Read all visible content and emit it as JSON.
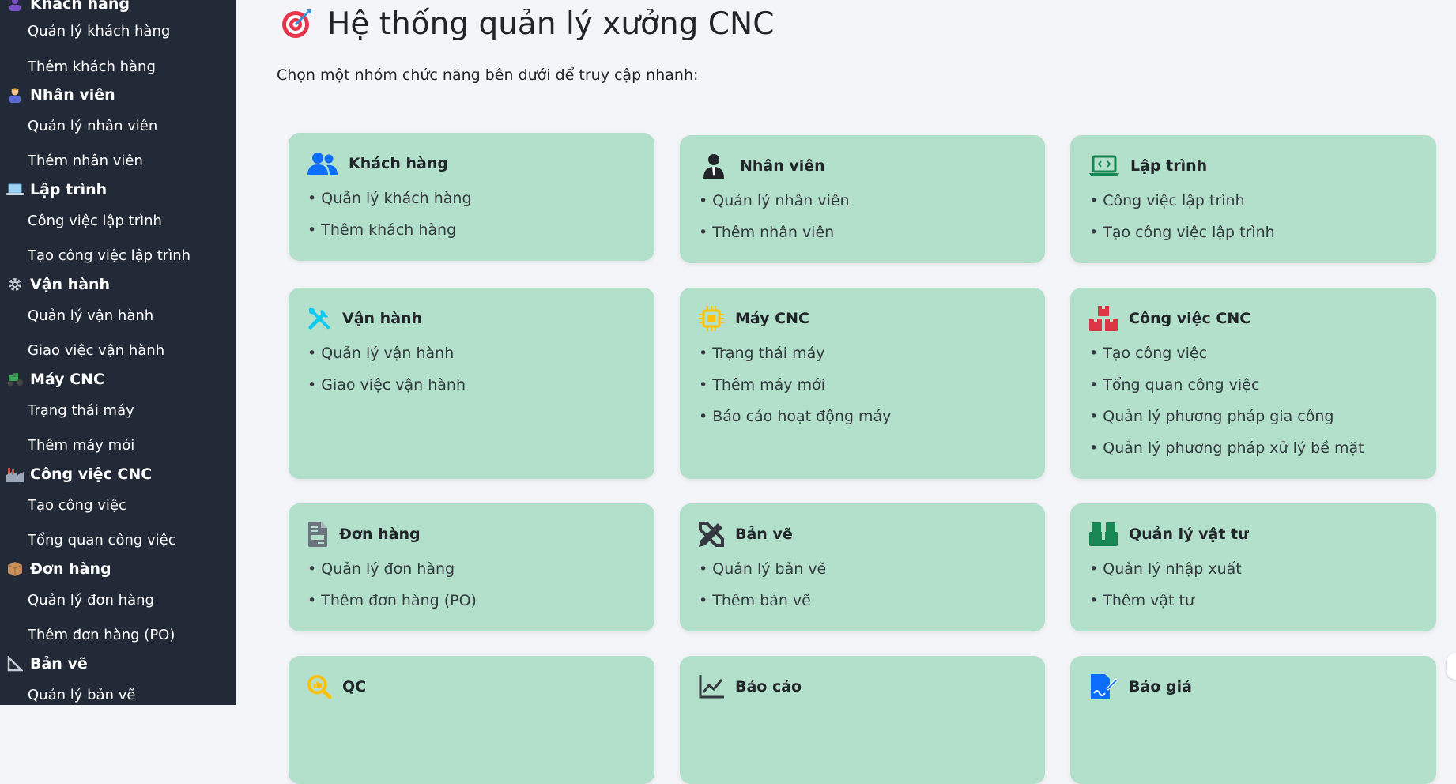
{
  "sidebar": {
    "groups": [
      {
        "title": "Khách hàng",
        "icon": "purple-person-icon",
        "links": [
          "Quản lý khách hàng",
          "Thêm khách hàng"
        ]
      },
      {
        "title": "Nhân viên",
        "icon": "worker-icon",
        "links": [
          "Quản lý nhân viên",
          "Thêm nhân viên"
        ]
      },
      {
        "title": "Lập trình",
        "icon": "laptop-icon",
        "links": [
          "Công việc lập trình",
          "Tạo công việc lập trình"
        ]
      },
      {
        "title": "Vận hành",
        "icon": "gear-icon",
        "links": [
          "Quản lý vận hành",
          "Giao việc vận hành"
        ]
      },
      {
        "title": "Máy CNC",
        "icon": "tractor-icon",
        "links": [
          "Trạng thái máy",
          "Thêm máy mới"
        ]
      },
      {
        "title": "Công việc CNC",
        "icon": "factory-icon",
        "links": [
          "Tạo công việc",
          "Tổng quan công việc"
        ]
      },
      {
        "title": "Đơn hàng",
        "icon": "package-icon",
        "links": [
          "Quản lý đơn hàng",
          "Thêm đơn hàng (PO)"
        ]
      },
      {
        "title": "Bản vẽ",
        "icon": "triangle-ruler-icon",
        "links": [
          "Quản lý bản vẽ"
        ]
      }
    ]
  },
  "main": {
    "title": "Hệ thống quản lý xưởng CNC",
    "title_icon": "target-icon",
    "subtitle": "Chọn một nhóm chức năng bên dưới để truy cập nhanh:",
    "cards": [
      {
        "title": "Khách hàng",
        "icon": "people-icon",
        "icon_color": "#0d6efd",
        "items": [
          "• Quản lý khách hàng",
          "• Thêm khách hàng"
        ]
      },
      {
        "title": "Nhân viên",
        "icon": "person-tie-icon",
        "icon_color": "#212529",
        "items": [
          "• Quản lý nhân viên",
          "• Thêm nhân viên"
        ]
      },
      {
        "title": "Lập trình",
        "icon": "laptop-code-icon",
        "icon_color": "#198754",
        "items": [
          "• Công việc lập trình",
          "• Tạo công việc lập trình"
        ]
      },
      {
        "title": "Vận hành",
        "icon": "tools-icon",
        "icon_color": "#0dcaf0",
        "items": [
          "• Quản lý vận hành",
          "• Giao việc vận hành"
        ]
      },
      {
        "title": "Máy CNC",
        "icon": "cpu-icon",
        "icon_color": "#ffc107",
        "items": [
          "• Trạng thái máy",
          "• Thêm máy mới",
          "• Báo cáo hoạt động máy"
        ]
      },
      {
        "title": "Công việc CNC",
        "icon": "boxes-icon",
        "icon_color": "#dc3545",
        "items": [
          "• Tạo công việc",
          "• Tổng quan công việc",
          "• Quản lý phương pháp gia công",
          "• Quản lý phương pháp xử lý bề mặt"
        ]
      },
      {
        "title": "Đơn hàng",
        "icon": "document-icon",
        "icon_color": "#6c757d",
        "items": [
          "• Quản lý đơn hàng",
          "• Thêm đơn hàng (PO)"
        ]
      },
      {
        "title": "Bản vẽ",
        "icon": "pencil-ruler-icon",
        "icon_color": "#343a40",
        "items": [
          "• Quản lý bản vẽ",
          "• Thêm bản vẽ"
        ]
      },
      {
        "title": "Quản lý vật tư",
        "icon": "stacked-boxes-icon",
        "icon_color": "#198754",
        "items": [
          "• Quản lý nhập xuất",
          "• Thêm vật tư"
        ]
      },
      {
        "title": "QC",
        "icon": "search-chart-icon",
        "icon_color": "#ffc107",
        "items": []
      },
      {
        "title": "Báo cáo",
        "icon": "line-chart-icon",
        "icon_color": "#343a40",
        "items": []
      },
      {
        "title": "Báo giá",
        "icon": "signed-doc-icon",
        "icon_color": "#0d6efd",
        "items": []
      }
    ]
  }
}
